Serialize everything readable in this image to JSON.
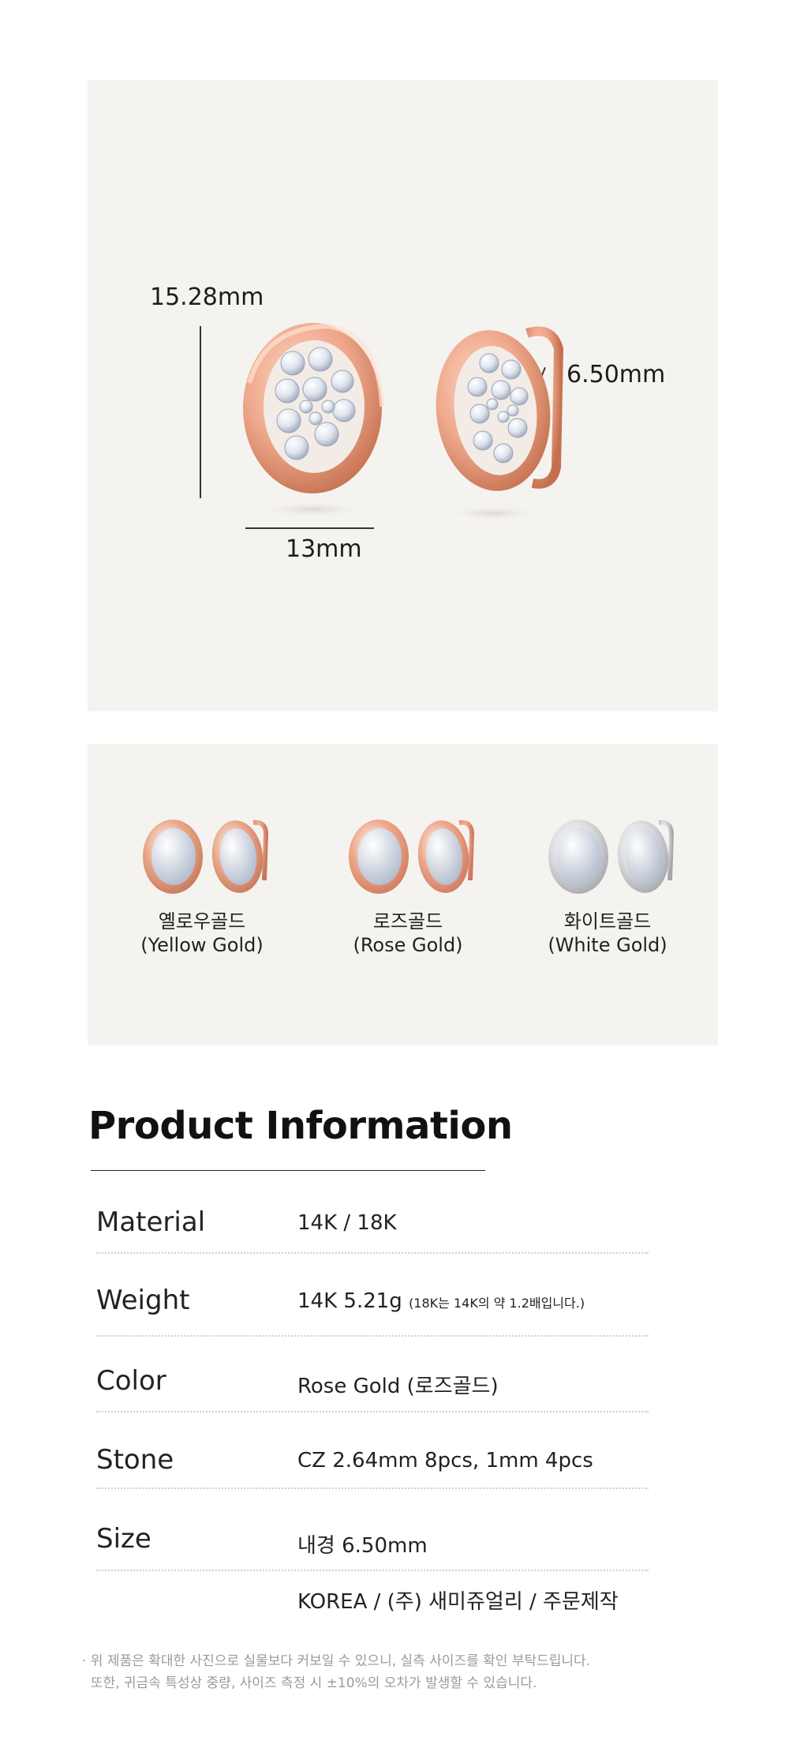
{
  "dimensions": {
    "height": "15.28mm",
    "width": "13mm",
    "inner": "6.50mm"
  },
  "colors": [
    {
      "korean": "옐로우골드",
      "english": "(Yellow Gold)",
      "metal": "#e9a98a",
      "metal_dark": "#c7775a"
    },
    {
      "korean": "로즈골드",
      "english": "(Rose Gold)",
      "metal": "#eea88c",
      "metal_dark": "#cf7a5e"
    },
    {
      "korean": "화이트골드",
      "english": "(White Gold)",
      "metal": "#dcdde0",
      "metal_dark": "#a5a7ad"
    }
  ],
  "product_info": {
    "title": "Product Information",
    "rows": [
      {
        "label": "Material",
        "value": "14K / 18K",
        "note": ""
      },
      {
        "label": "Weight",
        "value": "14K 5.21g",
        "note": "(18K는 14K의 약 1.2배입니다.)"
      },
      {
        "label": "Color",
        "value": "Rose Gold (로즈골드)",
        "note": ""
      },
      {
        "label": "Stone",
        "value": "CZ 2.64mm 8pcs, 1mm 4pcs",
        "note": ""
      },
      {
        "label": "Size",
        "value": "내경 6.50mm",
        "note": ""
      }
    ],
    "origin": "KOREA / (주) 새미쥬얼리 / 주문제작"
  },
  "notes": [
    "· 위 제품은 확대한 사진으로 실물보다 커보일 수 있으니, 실측 사이즈를 확인 부탁드립니다.",
    "  또한, 귀금속 특성상 중량, 사이즈 측정 시 ±10%의 오차가 발생할 수 있습니다."
  ],
  "palette": {
    "panel_bg": "#f5f3ef",
    "rose_gold": "#eea88c",
    "stone": "#e8ecf3"
  }
}
